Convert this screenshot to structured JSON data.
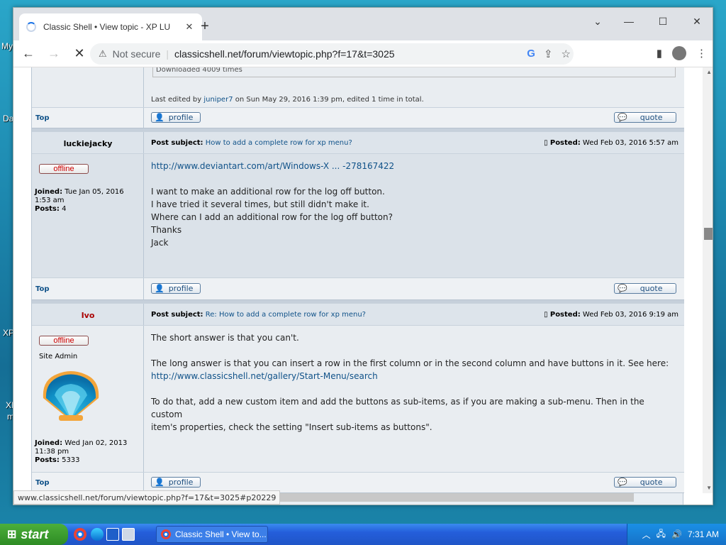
{
  "desktop": {
    "labels": [
      "My",
      "Da",
      "XP",
      "XI",
      "m"
    ]
  },
  "browser": {
    "tab_title": "Classic Shell • View topic - XP LU",
    "new_tab": "+",
    "window_controls": {
      "minimize": "⌄",
      "restore": "—",
      "maximize": "☐",
      "close": "✕"
    },
    "not_secure": "Not secure",
    "url": "classicshell.net/forum/viewtopic.php?f=17&t=3025",
    "status_url": "www.classicshell.net/forum/viewtopic.php?f=17&t=3025#p20229"
  },
  "forum": {
    "partial_top": {
      "downloaded": "Downloaded 4009 times",
      "edit_prefix": "Last edited by ",
      "edit_user": "juniper7",
      "edit_suffix": " on Sun May 29, 2016 1:39 pm, edited 1 time in total."
    },
    "top_label": "Top",
    "profile_label": "profile",
    "quote_label": "quote",
    "offline_label": "offline",
    "post_subject_label": "Post subject:",
    "posted_label": "Posted:",
    "joined_label": "Joined:",
    "posts_label": "Posts:",
    "posts": [
      {
        "author": "luckiejacky",
        "subject": "How to add a complete row for xp menu?",
        "posted": "Wed Feb 03, 2016 5:57 am",
        "joined": "Tue Jan 05, 2016 1:53 am",
        "post_count": "4",
        "link": "http://www.deviantart.com/art/Windows-X ... -278167422",
        "lines": [
          "I want to make an additional row for the log off button.",
          "I have tried it several times, but still didn't make it.",
          "Where can I add an additional row for the log off button?",
          "Thanks",
          "Jack"
        ]
      },
      {
        "author": "Ivo",
        "rank": "Site Admin",
        "subject": "Re: How to add a complete row for xp menu?",
        "posted": "Wed Feb 03, 2016 9:19 am",
        "joined": "Wed Jan 02, 2013 11:38 pm",
        "post_count": "5333",
        "p1": "The short answer is that you can't.",
        "p2": "The long answer is that you can insert a row in the first column or in the second column and have buttons in it. See here:",
        "link": "http://www.classicshell.net/gallery/Start-Menu/search",
        "p3a": "To do that, add a new custom item and add the buttons as sub-items, as if you are making a sub-menu. Then in the custom",
        "p3b": "item's properties, check the setting \"Insert sub-items as buttons\"."
      }
    ]
  },
  "taskbar": {
    "start": "start",
    "task_title": "Classic Shell • View to...",
    "clock": "7:31 AM"
  },
  "colors": {
    "accent": "#105289",
    "admin": "#aa0000"
  }
}
